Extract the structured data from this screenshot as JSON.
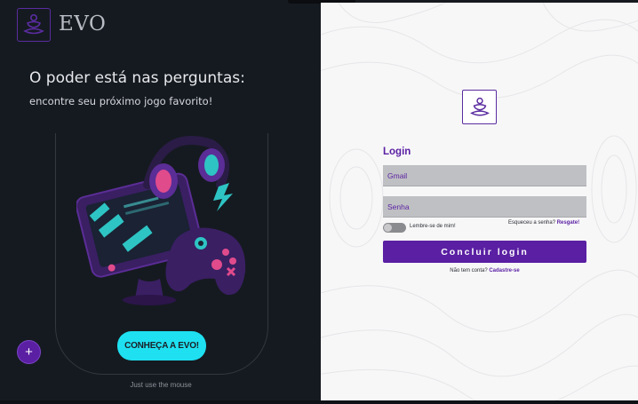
{
  "brand": {
    "name": "EVO",
    "accent_color": "#5a1fa3",
    "cta_color": "#1ee0f0"
  },
  "hero": {
    "headline": "O poder está nas perguntas:",
    "subline": "encontre seu próximo jogo favorito!",
    "cta_label": "CONHEÇA A EVO!",
    "hint": "Just use the mouse",
    "fab_icon": "plus-icon",
    "illustration": "gaming-monitor-headphones-controller"
  },
  "login": {
    "title": "Login",
    "gmail_placeholder": "Gmail",
    "password_placeholder": "Senha",
    "remember_label": "Lembre-se de mim!",
    "remember_checked": false,
    "forgot_text": "Esqueceu a senha?",
    "forgot_link": "Resgate!",
    "submit_label": "Concluir login",
    "signup_text": "Não tem conta?",
    "signup_link": "Cadastre-se"
  }
}
